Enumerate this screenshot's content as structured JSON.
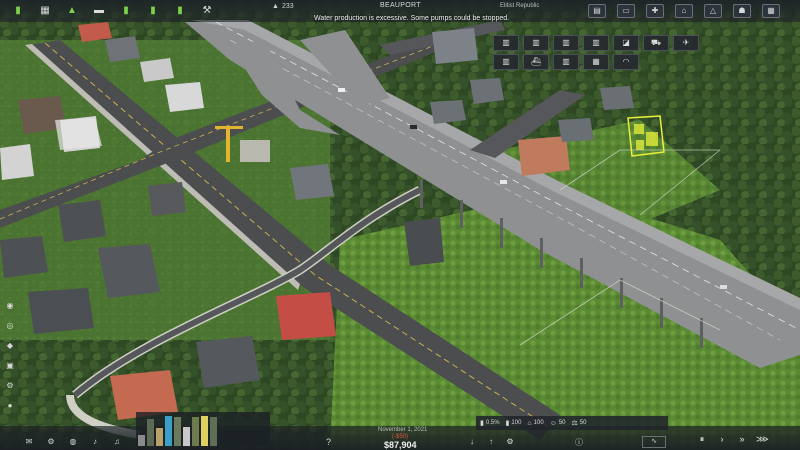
{
  "top_bar": {
    "population_icon": "person-icon",
    "population": "233",
    "city_name": "BEAUPORT",
    "republic": "Elitist Republic",
    "notification": "Water production is excessive. Some pumps could be stopped."
  },
  "top_left_icons": [
    "stats-icon",
    "building-icon",
    "construction-icon",
    "road-icon",
    "budget-icon",
    "industry-icon",
    "houses-icon",
    "hammer-icon"
  ],
  "top_right_icons": [
    "book-icon",
    "bulldoze-icon",
    "tools-icon",
    "terrain-icon",
    "warning-icon",
    "people-icon",
    "settings-icon"
  ],
  "palette": {
    "row1": [
      "residential-icon",
      "commercial-icon",
      "industrial-icon",
      "office-icon",
      "farm-icon",
      "truck-icon",
      "airport-icon"
    ],
    "row2": [
      "utility-icon",
      "ship-icon",
      "rail-icon",
      "storage-icon",
      "special-icon"
    ]
  },
  "left_bar_icons": [
    "demolish-icon",
    "eye-icon",
    "layer-icon",
    "zoning-icon",
    "gear-icon",
    "pin-icon"
  ],
  "bottom": {
    "date": "November 1, 2021",
    "funds_change": "(-$50)",
    "funds": "$87,904",
    "help_label": "?",
    "left_icons": [
      "mail-icon",
      "settings-icon",
      "globe-icon",
      "bell-icon",
      "sound-icon",
      "hammer-icon"
    ],
    "controls": [
      "download-icon",
      "upload-icon",
      "gear-icon"
    ],
    "status": [
      {
        "icon": "population-icon",
        "value": "0.5%"
      },
      {
        "icon": "industry-icon",
        "value": "100"
      },
      {
        "icon": "housing-icon",
        "value": "100"
      },
      {
        "icon": "happy-icon",
        "value": "50"
      },
      {
        "icon": "trade-icon",
        "value": "50"
      }
    ],
    "speed": [
      "pause-icon",
      "play-icon",
      "fast-icon",
      "fastest-icon"
    ]
  },
  "resource_levels": [
    {
      "color": "#8b8b8b",
      "level": 0.35
    },
    {
      "color": "#5c6a54",
      "level": 0.85
    },
    {
      "color": "#b9a16a",
      "level": 0.55
    },
    {
      "color": "#3aa0c8",
      "level": 0.95
    },
    {
      "color": "#6b7a5c",
      "level": 0.9
    },
    {
      "color": "#c8c8c8",
      "level": 0.6
    },
    {
      "color": "#6d7b4e",
      "level": 0.9
    },
    {
      "color": "#e0d060",
      "level": 0.95
    },
    {
      "color": "#5f6f55",
      "level": 0.9
    }
  ]
}
